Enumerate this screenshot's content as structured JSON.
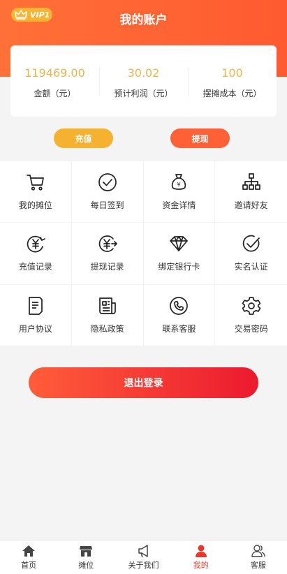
{
  "header": {
    "title": "我的账户",
    "vip_label": "VIP1",
    "bg_color": "#ff6a35"
  },
  "stats": [
    {
      "value": "119469.00",
      "label": "金额（元）"
    },
    {
      "value": "30.02",
      "label": "预计利润（元）"
    },
    {
      "value": "100",
      "label": "摆摊成本（元）"
    }
  ],
  "actions": {
    "charge_label": "充值",
    "withdraw_label": "提现"
  },
  "menu": [
    {
      "label": "我的摊位",
      "icon": "cart-icon"
    },
    {
      "label": "每日签到",
      "icon": "check-circle-icon"
    },
    {
      "label": "资金详情",
      "icon": "money-bag-icon"
    },
    {
      "label": "邀请好友",
      "icon": "network-icon"
    },
    {
      "label": "充值记录",
      "icon": "yen-recharge-icon"
    },
    {
      "label": "提现记录",
      "icon": "yen-withdraw-icon"
    },
    {
      "label": "绑定银行卡",
      "icon": "diamond-icon"
    },
    {
      "label": "实名认证",
      "icon": "verified-icon"
    },
    {
      "label": "用户协议",
      "icon": "document-icon"
    },
    {
      "label": "隐私政策",
      "icon": "newspaper-icon"
    },
    {
      "label": "联系客服",
      "icon": "phone-icon"
    },
    {
      "label": "交易密码",
      "icon": "gear-icon"
    }
  ],
  "logout_label": "退出登录",
  "tabbar": [
    {
      "label": "首页",
      "icon": "home-icon"
    },
    {
      "label": "摊位",
      "icon": "stall-icon"
    },
    {
      "label": "关于我们",
      "icon": "megaphone-icon"
    },
    {
      "label": "我的",
      "icon": "user-icon",
      "active": true
    },
    {
      "label": "客服",
      "icon": "support-icon"
    }
  ],
  "colors": {
    "accent": "#ff6035",
    "gold": "#e8b74e",
    "active_tab": "#e8382c"
  }
}
